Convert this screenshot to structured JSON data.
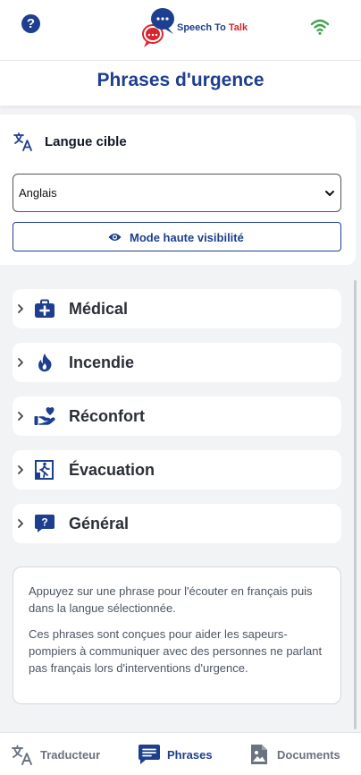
{
  "app": {
    "logo_part1": "Speech To ",
    "logo_part2": "Talk",
    "help_symbol": "?",
    "connection_icon": "wifi-icon"
  },
  "colors": {
    "primary": "#1e3f8f",
    "accent": "#d7262b",
    "wifi": "#3fa34d",
    "muted": "#6b7280"
  },
  "header": {
    "title": "Phrases d'urgence"
  },
  "language": {
    "label": "Langue cible",
    "selected": "Anglais",
    "visibility_button": "Mode haute visibilité"
  },
  "categories": [
    {
      "label": "Médical",
      "icon": "medical-kit-icon"
    },
    {
      "label": "Incendie",
      "icon": "fire-icon"
    },
    {
      "label": "Réconfort",
      "icon": "hand-heart-icon"
    },
    {
      "label": "Évacuation",
      "icon": "emergency-exit-icon"
    },
    {
      "label": "Général",
      "icon": "question-bubble-icon"
    }
  ],
  "info": {
    "p1": "Appuyez sur une phrase pour l'écouter en français puis dans la langue sélectionnée.",
    "p2": "Ces phrases sont conçues pour aider les sapeurs-pompiers à communiquer avec des personnes ne parlant pas français lors d'interventions d'urgence."
  },
  "nav": [
    {
      "label": "Traducteur",
      "icon": "translate-icon",
      "active": false
    },
    {
      "label": "Phrases",
      "icon": "chat-icon",
      "active": true
    },
    {
      "label": "Documents",
      "icon": "document-image-icon",
      "active": false
    }
  ]
}
